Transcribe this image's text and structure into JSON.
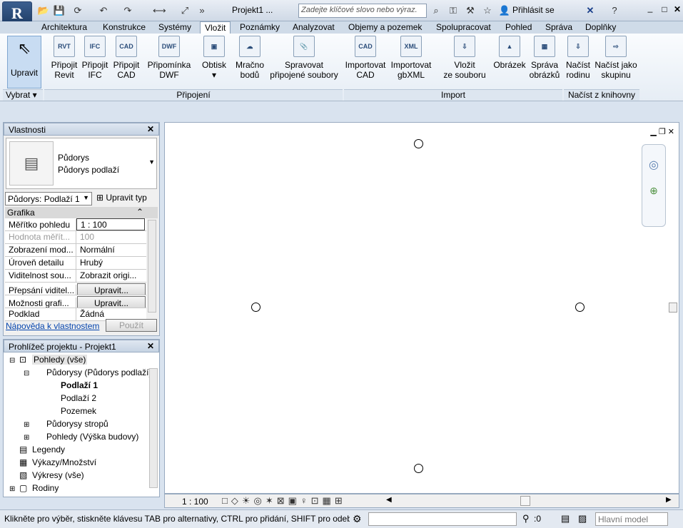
{
  "titlebar": {
    "app_logo": "R",
    "doc_title": "Projekt1 ...",
    "search_placeholder": "Zadejte klíčové slovo nebo výraz.",
    "signin": "Přihlásit se"
  },
  "tabs": [
    "Architektura",
    "Konstrukce",
    "Systémy",
    "Vložit",
    "Poznámky",
    "Analyzovat",
    "Objemy a pozemek",
    "Spolupracovat",
    "Pohled",
    "Správa",
    "Doplňky"
  ],
  "ribbon": {
    "modify": {
      "line1": "Upravit",
      "line2": ""
    },
    "buttons": [
      {
        "l1": "Připojit",
        "l2": "Revit",
        "ico": "RVT"
      },
      {
        "l1": "Připojit",
        "l2": "IFC",
        "ico": "IFC"
      },
      {
        "l1": "Připojit",
        "l2": "CAD",
        "ico": "CAD"
      },
      {
        "l1": "Připomínka",
        "l2": "DWF",
        "ico": "DWF"
      },
      {
        "l1": "Obtisk",
        "l2": "▾",
        "ico": "▣"
      },
      {
        "l1": "Mračno",
        "l2": "bodů",
        "ico": "☁"
      },
      {
        "l1": "Spravovat",
        "l2": "připojené soubory",
        "ico": "📎"
      },
      {
        "l1": "Importovat",
        "l2": "CAD",
        "ico": "CAD"
      },
      {
        "l1": "Importovat",
        "l2": "gbXML",
        "ico": "XML"
      },
      {
        "l1": "Vložit",
        "l2": "ze souboru",
        "ico": "⇩"
      },
      {
        "l1": "Obrázek",
        "l2": "",
        "ico": "▲"
      },
      {
        "l1": "Správa",
        "l2": "obrázků",
        "ico": "▦"
      },
      {
        "l1": "Načíst",
        "l2": "rodinu",
        "ico": "⇩"
      },
      {
        "l1": "Načíst jako",
        "l2": "skupinu",
        "ico": "⇨"
      }
    ],
    "panels": [
      "Vybrat ▾",
      "Připojení",
      "Import",
      "Načíst z knihovny"
    ]
  },
  "properties": {
    "title": "Vlastnosti",
    "type_line1": "Půdorys",
    "type_line2": "Půdorys podlaží",
    "selector": "Půdorys: Podlaží 1",
    "edit_type": "Upravit typ",
    "section": "Grafika",
    "rows": [
      {
        "k": "Měřítko pohledu",
        "v": "1 : 100"
      },
      {
        "k": "Hodnota měřít...",
        "v": "100"
      },
      {
        "k": "Zobrazení mod...",
        "v": "Normální"
      },
      {
        "k": "Úroveň detailu",
        "v": "Hrubý"
      },
      {
        "k": "Viditelnost sou...",
        "v": "Zobrazit origi..."
      },
      {
        "k": "Přepsání viditel...",
        "v": "Upravit..."
      },
      {
        "k": "Možnosti grafi...",
        "v": "Upravit..."
      },
      {
        "k": "Podklad",
        "v": "Žádná"
      }
    ],
    "help_link": "Nápověda k vlastnostem",
    "apply": "Použít"
  },
  "browser": {
    "title": "Prohlížeč projektu - Projekt1",
    "items": [
      {
        "label": "Pohledy (vše)",
        "indent": 0
      },
      {
        "label": "Půdorysy (Půdorys podlaží)",
        "indent": 1
      },
      {
        "label": "Podlaží 1",
        "indent": 2
      },
      {
        "label": "Podlaží 2",
        "indent": 2
      },
      {
        "label": "Pozemek",
        "indent": 2
      },
      {
        "label": "Půdorysy stropů",
        "indent": 1
      },
      {
        "label": "Pohledy (Výška budovy)",
        "indent": 1
      },
      {
        "label": "Legendy",
        "indent": 0
      },
      {
        "label": "Výkazy/Množství",
        "indent": 0
      },
      {
        "label": "Výkresy (vše)",
        "indent": 0
      },
      {
        "label": "Rodiny",
        "indent": 0
      }
    ]
  },
  "viewbar": {
    "scale": "1 : 100"
  },
  "status": {
    "text": "Klikněte pro výběr, stiskněte klávesu TAB pro alternativy, CTRL pro přidání, SHIFT pro odebr",
    "count": ":0",
    "model": "Hlavní model"
  }
}
